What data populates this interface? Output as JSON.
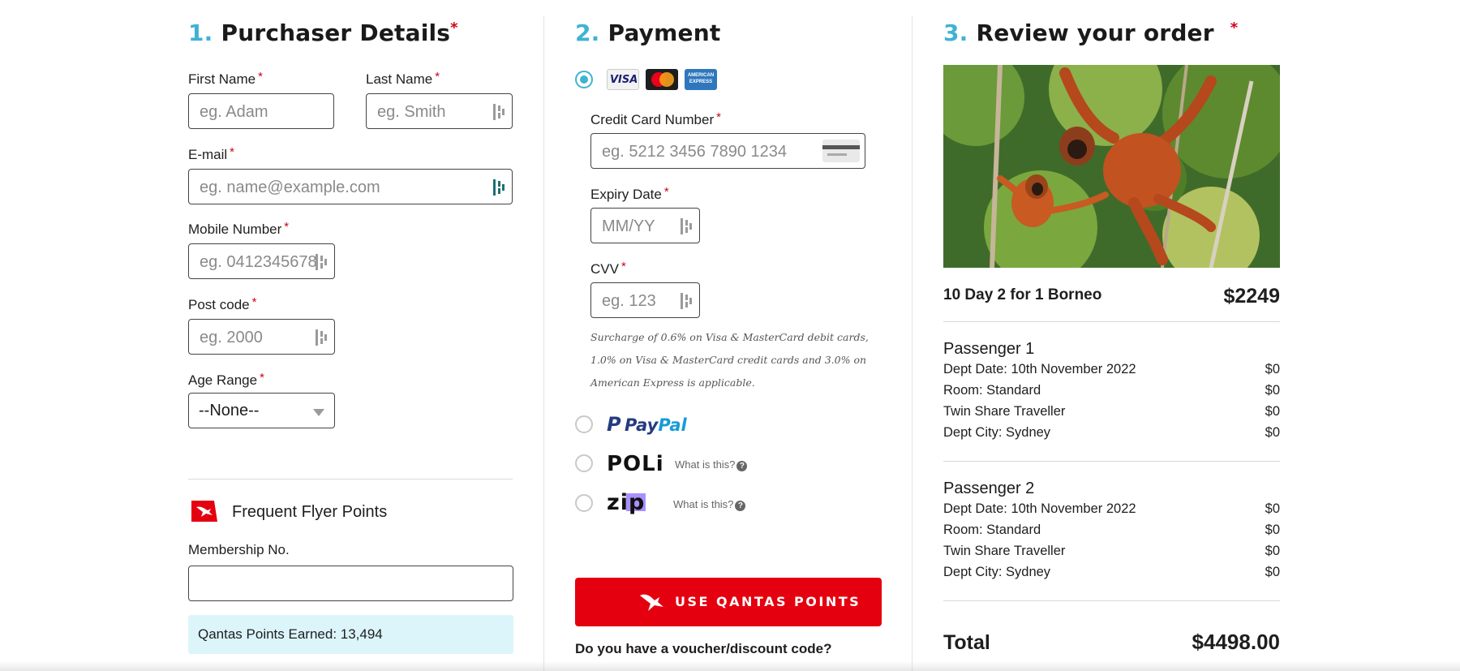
{
  "purchaser": {
    "num": "1.",
    "title": "Purchaser Details",
    "first_name": {
      "label": "First Name",
      "placeholder": "eg. Adam"
    },
    "last_name": {
      "label": "Last Name",
      "placeholder": "eg. Smith"
    },
    "email": {
      "label": "E-mail",
      "placeholder": "eg. name@example.com"
    },
    "mobile": {
      "label": "Mobile Number",
      "placeholder": "eg. 0412345678"
    },
    "postcode": {
      "label": "Post code",
      "placeholder": "eg. 2000"
    },
    "age_range": {
      "label": "Age Range",
      "value": "--None--"
    },
    "ffp": {
      "title": "Frequent Flyer Points",
      "membership_label": "Membership No.",
      "membership_value": "",
      "earned": "Qantas Points Earned: 13,494"
    }
  },
  "payment": {
    "num": "2.",
    "title": "Payment",
    "cards": {
      "visa": "VISA",
      "amex": "AMERICAN EXPRESS"
    },
    "card_number": {
      "label": "Credit Card Number",
      "placeholder": "eg. 5212 3456 7890 1234"
    },
    "expiry": {
      "label": "Expiry Date",
      "placeholder": "MM/YY"
    },
    "cvv": {
      "label": "CVV",
      "placeholder": "eg. 123"
    },
    "surcharge_note": "Surcharge of 0.6% on Visa & MasterCard debit cards, 1.0% on Visa & MasterCard credit cards and 3.0% on American Express is applicable.",
    "paypal": {
      "pay": "Pay",
      "pal": "Pal"
    },
    "poli": {
      "logo": "POLi",
      "what": "What is this?"
    },
    "zip": {
      "logo": "zip",
      "what": "What is this?"
    },
    "qantas_button": "USE QANTAS POINTS",
    "voucher_prompt": "Do you have a voucher/discount code?"
  },
  "review": {
    "num": "3.",
    "title": "Review your order",
    "tour_name": "10 Day 2 for 1 Borneo",
    "tour_price": "$2249",
    "passengers": [
      {
        "title": "Passenger 1",
        "lines": [
          {
            "label": "Dept Date: 10th November 2022",
            "price": "$0"
          },
          {
            "label": "Room: Standard",
            "price": "$0"
          },
          {
            "label": "Twin Share Traveller",
            "price": "$0"
          },
          {
            "label": "Dept City: Sydney",
            "price": "$0"
          }
        ]
      },
      {
        "title": "Passenger 2",
        "lines": [
          {
            "label": "Dept Date: 10th November 2022",
            "price": "$0"
          },
          {
            "label": "Room: Standard",
            "price": "$0"
          },
          {
            "label": "Twin Share Traveller",
            "price": "$0"
          },
          {
            "label": "Dept City: Sydney",
            "price": "$0"
          }
        ]
      }
    ],
    "total_label": "Total",
    "total_value": "$4498.00"
  },
  "colors": {
    "accent": "#3fb3d3",
    "required": "#d0021b",
    "qantas_red": "#e4000f"
  },
  "icons": {
    "autofill": "key-autofill-icon",
    "card": "credit-card-icon",
    "qantas": "qantas-kangaroo-icon",
    "help": "question-circle-icon"
  }
}
